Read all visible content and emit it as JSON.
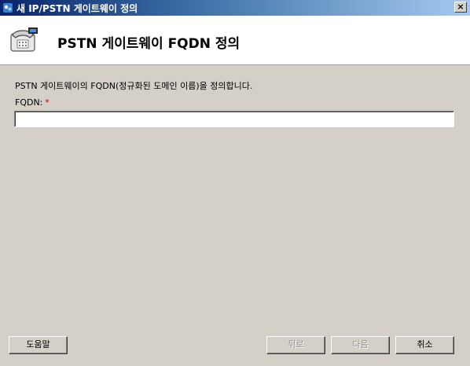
{
  "window": {
    "title": "새 IP/PSTN 게이트웨이 정의",
    "close_label": "×",
    "title_icon": "app-icon"
  },
  "header": {
    "title": "PSTN 게이트웨이 FQDN 정의",
    "icon": "telephone-icon"
  },
  "body": {
    "description": "PSTN 게이트웨이의 FQDN(정규화된 도메인 이름)을 정의합니다.",
    "fqdn_label": "FQDN:",
    "required_marker": "*",
    "fqdn_value": ""
  },
  "buttons": {
    "help": "도움말",
    "back": "뒤로",
    "next": "다음",
    "cancel": "취소"
  },
  "colors": {
    "accent_titlebar": "#0a246a",
    "required": "#c00000",
    "dialog_bg": "#d4d0c8"
  }
}
